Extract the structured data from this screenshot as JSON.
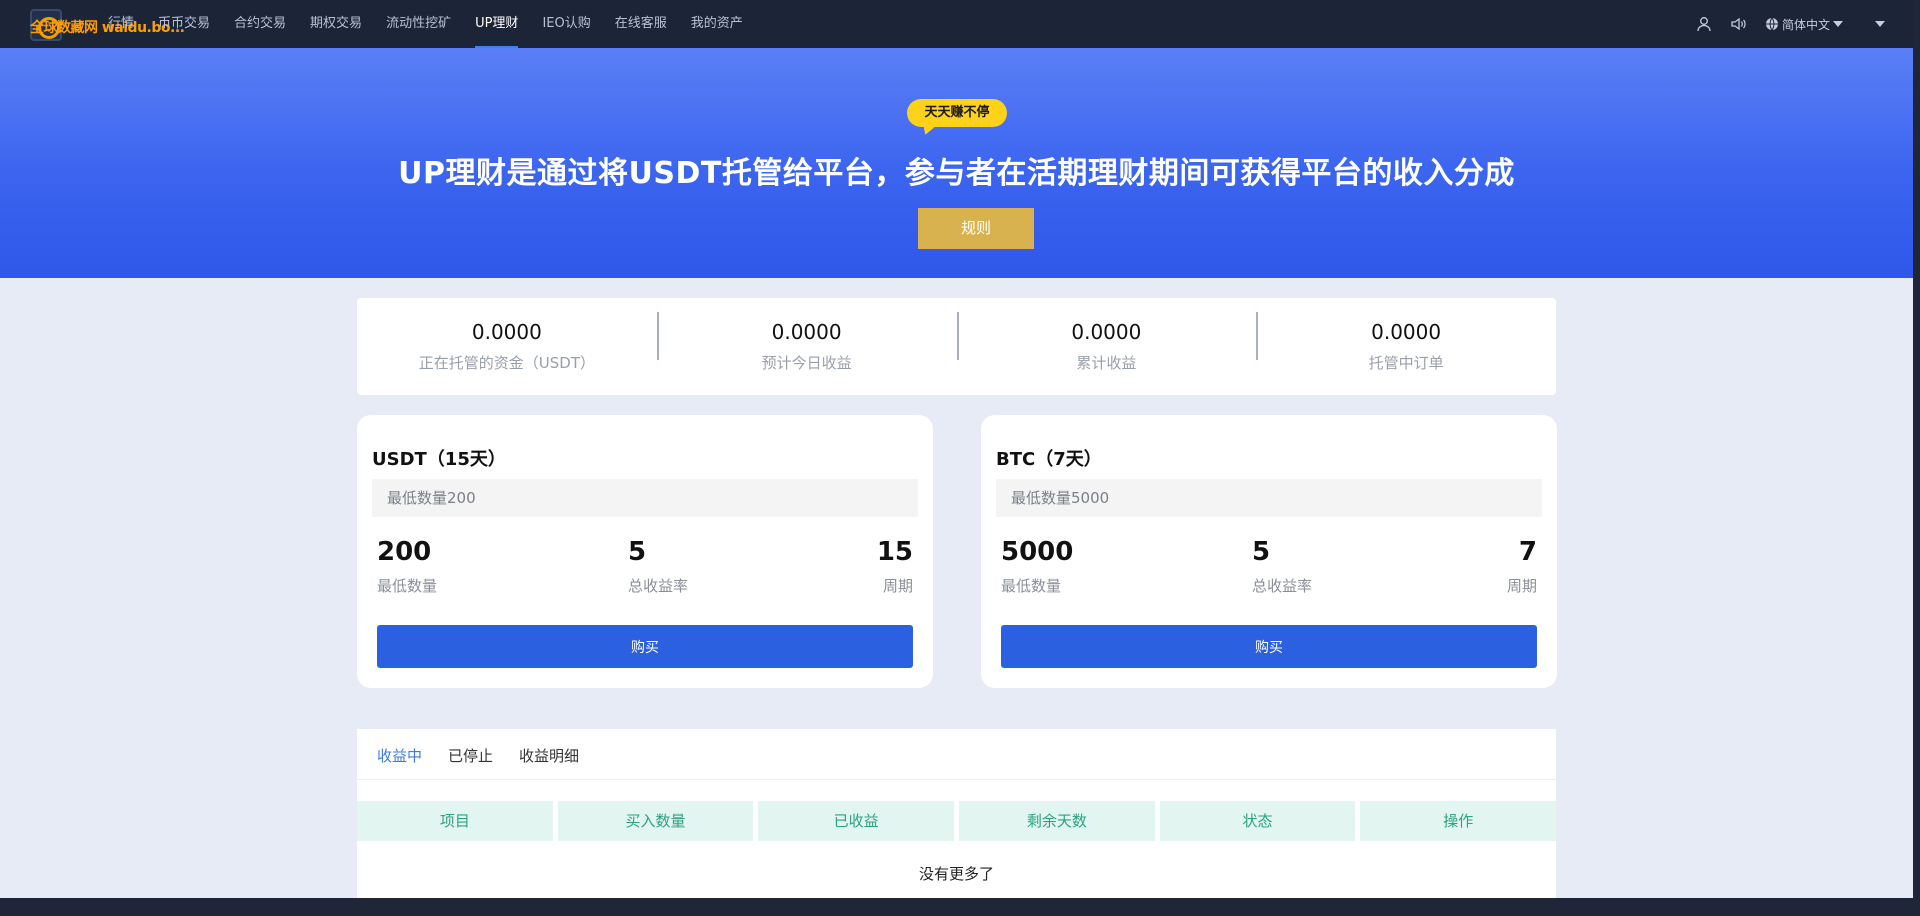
{
  "nav": {
    "logo_text": "全球数藏网 waidu.bo...",
    "items": [
      {
        "label": "行情"
      },
      {
        "label": "币币交易"
      },
      {
        "label": "合约交易"
      },
      {
        "label": "期权交易"
      },
      {
        "label": "流动性挖矿"
      },
      {
        "label": "UP理财",
        "active": true
      },
      {
        "label": "IEO认购"
      },
      {
        "label": "在线客服"
      },
      {
        "label": "我的资产"
      }
    ],
    "language": "简体中文"
  },
  "banner": {
    "bubble": "天天赚不停",
    "title": "UP理财是通过将USDT托管给平台，参与者在活期理财期间可获得平台的收入分成",
    "rules_button": "规则"
  },
  "stats": [
    {
      "value": "0.0000",
      "label": "正在托管的资金（USDT）"
    },
    {
      "value": "0.0000",
      "label": "预计今日收益"
    },
    {
      "value": "0.0000",
      "label": "累计收益"
    },
    {
      "value": "0.0000",
      "label": "托管中订单"
    }
  ],
  "products": [
    {
      "title": "USDT（15天）",
      "placeholder": "最低数量200",
      "min_value": "200",
      "min_label": "最低数量",
      "rate_value": "5",
      "rate_label": "总收益率",
      "period_value": "15",
      "period_label": "周期",
      "buy": "购买"
    },
    {
      "title": "BTC（7天）",
      "placeholder": "最低数量5000",
      "min_value": "5000",
      "min_label": "最低数量",
      "rate_value": "5",
      "rate_label": "总收益率",
      "period_value": "7",
      "period_label": "周期",
      "buy": "购买"
    }
  ],
  "orders": {
    "tabs": [
      {
        "label": "收益中",
        "active": true
      },
      {
        "label": "已停止"
      },
      {
        "label": "收益明细"
      }
    ],
    "columns": [
      "项目",
      "买入数量",
      "已收益",
      "剩余天数",
      "状态",
      "操作"
    ],
    "empty_text": "没有更多了"
  },
  "colors": {
    "accent": "#2b60e1",
    "gold": "#d8b24e",
    "table_header_bg": "#e2f5f0",
    "table_header_text": "#2aa37f"
  }
}
